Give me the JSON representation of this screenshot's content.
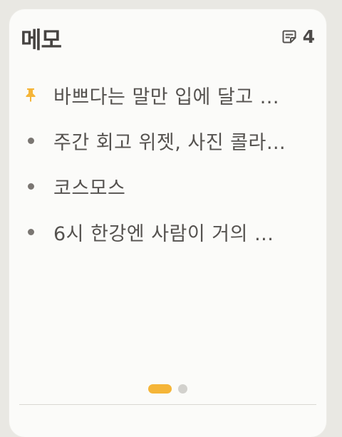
{
  "widget": {
    "title": "메모",
    "count": "4",
    "count_icon": "memo-note-icon",
    "accent_color": "#f5b538"
  },
  "memos": [
    {
      "text": "바쁘다는 말만 입에 달고 ...",
      "pinned": true,
      "icon": "pin-icon"
    },
    {
      "text": "주간 회고 위젯, 사진 콜라…",
      "pinned": false,
      "icon": "bullet-icon"
    },
    {
      "text": "코스모스",
      "pinned": false,
      "icon": "bullet-icon"
    },
    {
      "text": "6시 한강엔 사람이 거의 ...",
      "pinned": false,
      "icon": "bullet-icon"
    }
  ],
  "pager": {
    "total_pages": 2,
    "current_page": 1
  }
}
